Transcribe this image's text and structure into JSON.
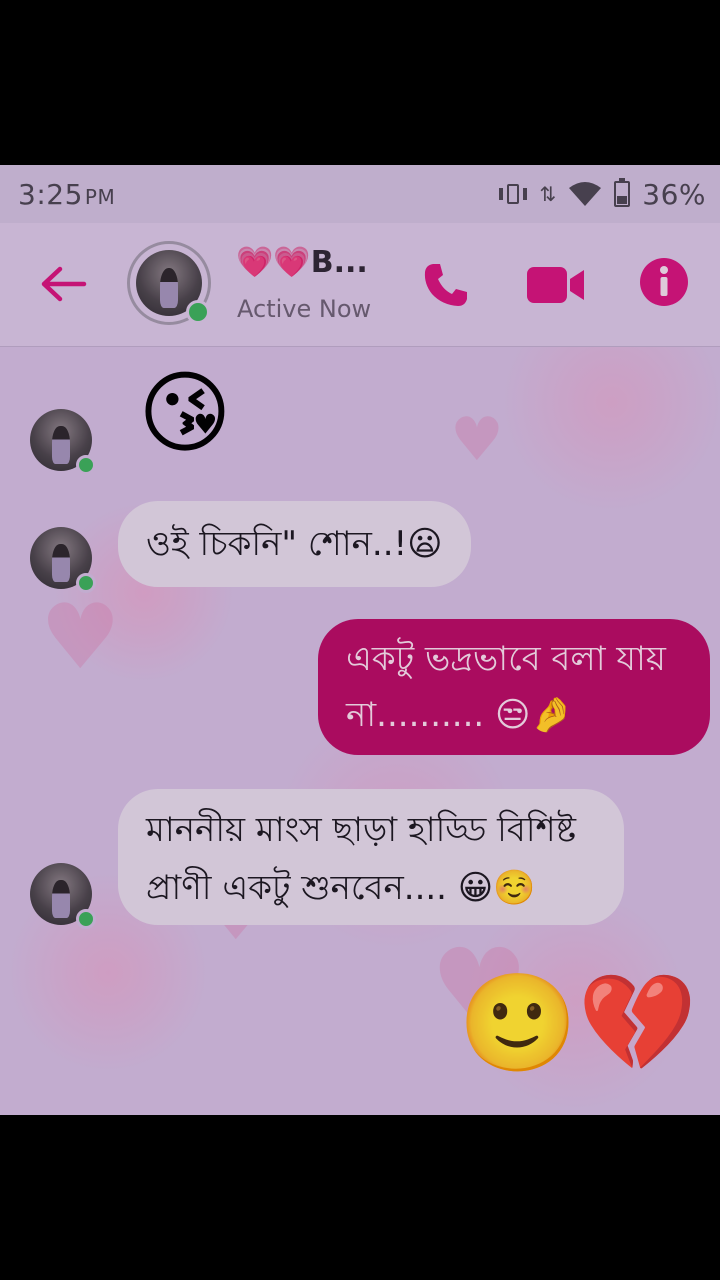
{
  "status_bar": {
    "time": "3:25",
    "ampm": "PM",
    "battery": "36%",
    "battery_level": 0.36
  },
  "header": {
    "name": "💗💗B...",
    "status": "Active Now",
    "icons": [
      "back-arrow-icon",
      "phone-icon",
      "video-camera-icon",
      "info-icon"
    ],
    "accent_color": "#d0147a"
  },
  "messages": [
    {
      "side": "in",
      "type": "emoji",
      "text": "😘"
    },
    {
      "side": "in",
      "type": "text",
      "text": "ওই চিকনি\" শোন..!😦"
    },
    {
      "side": "out",
      "type": "text",
      "line1": "একটু ভদ্রভাবে বলা যায়",
      "line2": "না.......... 😒🤌"
    },
    {
      "side": "in",
      "type": "text",
      "line1": "মাননীয় মাংস ছাড়া হাড্ডি বিশিষ্ট",
      "line2": "প্রাণী একটু শুনবেন.... 😀☺️"
    },
    {
      "side": "out",
      "type": "emoji",
      "text": "🙂💔"
    }
  ],
  "colors": {
    "outgoing_bubble": "#b30c62",
    "incoming_bubble": "#ddd2e2",
    "online": "#3cab5a"
  }
}
